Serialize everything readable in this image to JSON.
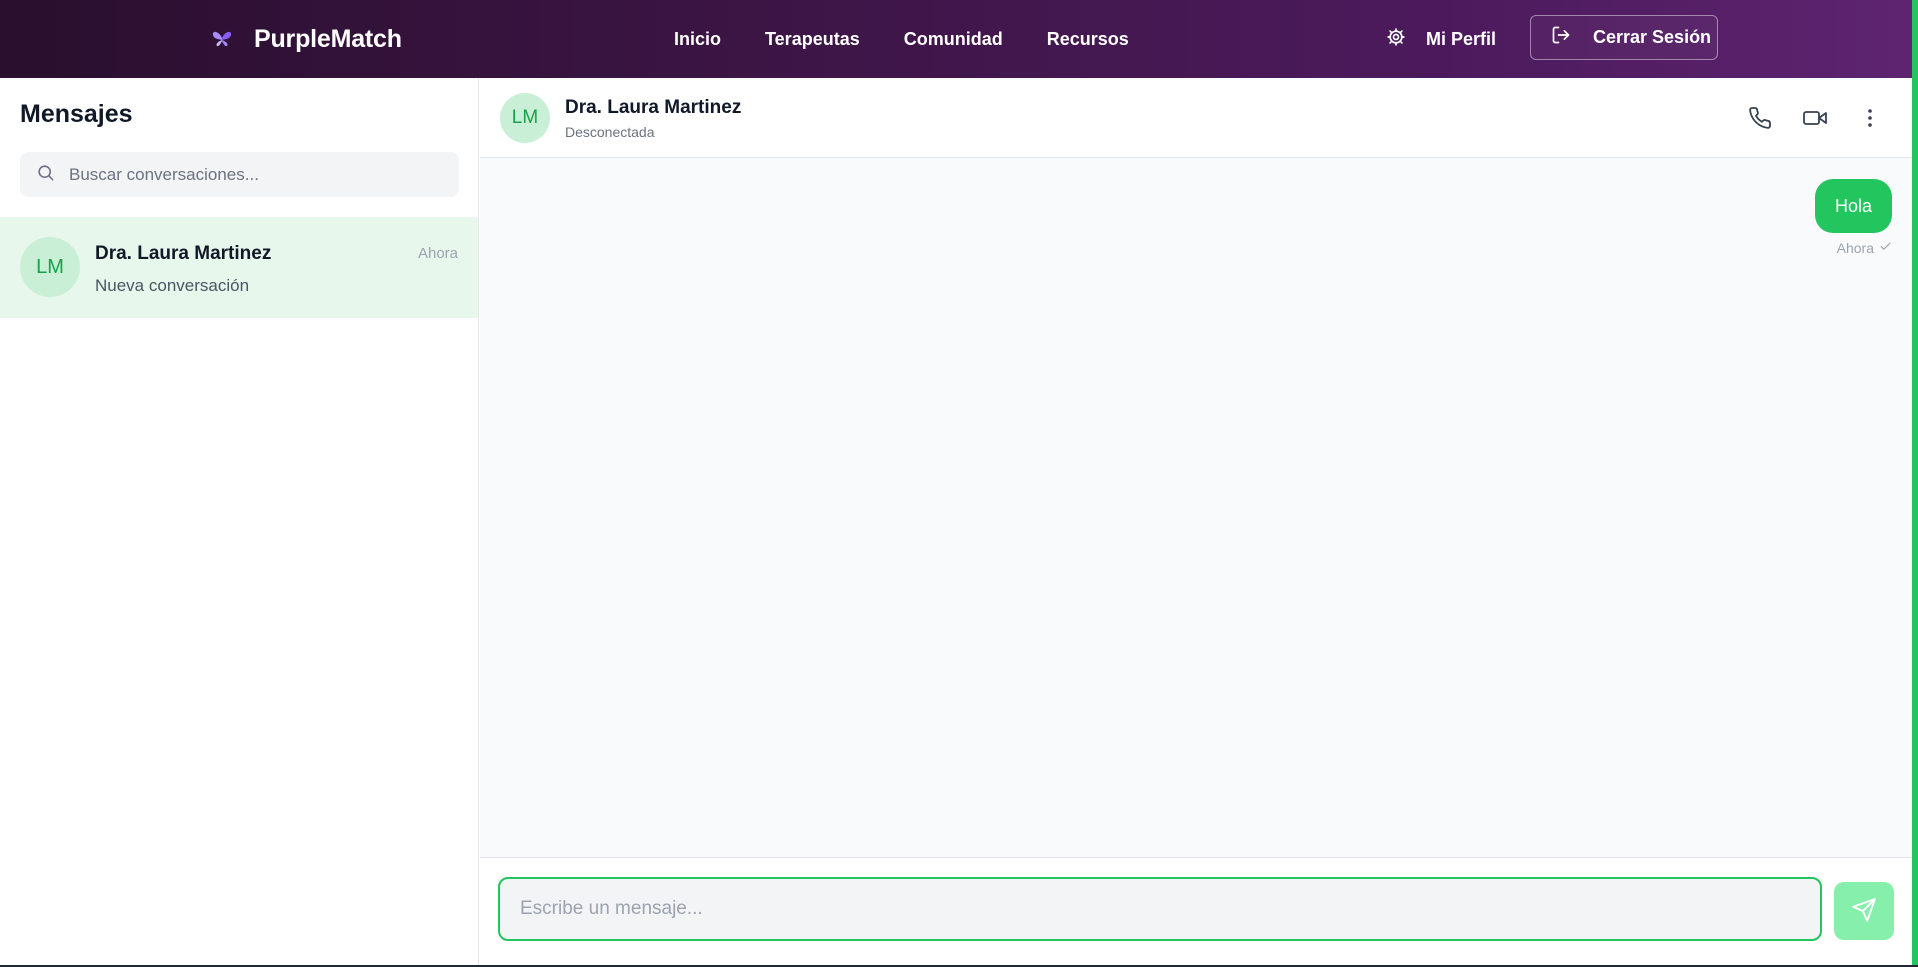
{
  "header": {
    "brand": "PurpleMatch",
    "nav": [
      "Inicio",
      "Terapeutas",
      "Comunidad",
      "Recursos"
    ],
    "profile_label": "Mi Perfil",
    "logout_label": "Cerrar Sesión",
    "logo_icon": "butterfly-icon"
  },
  "sidebar": {
    "title": "Mensajes",
    "search_placeholder": "Buscar conversaciones...",
    "conversations": [
      {
        "initials": "LM",
        "name": "Dra. Laura Martinez",
        "time": "Ahora",
        "preview": "Nueva conversación",
        "selected": true
      }
    ]
  },
  "chat": {
    "initials": "LM",
    "name": "Dra. Laura Martinez",
    "status": "Desconectada",
    "messages": [
      {
        "text": "Hola",
        "time": "Ahora",
        "sent": true
      }
    ],
    "input_placeholder": "Escribe un mensaje..."
  },
  "colors": {
    "accent": "#22c55e",
    "header_start": "#2a0f2e",
    "header_end": "#5e2470",
    "selected_row": "#e8f7ec"
  }
}
